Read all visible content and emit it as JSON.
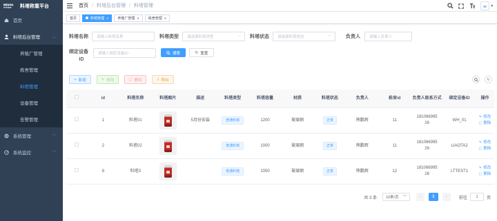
{
  "brand": {
    "logo_text": "智慧体系统 SYSTEM",
    "title": "料塔称重平台"
  },
  "sidebar": {
    "items": [
      {
        "label": "首页",
        "icon": "home-icon"
      },
      {
        "label": "料塔后台管理",
        "icon": "user-icon",
        "expanded": true
      },
      {
        "label": "系统管理",
        "icon": "gear-icon"
      },
      {
        "label": "系统监控",
        "icon": "monitor-icon"
      }
    ],
    "subitems": [
      {
        "label": "养殖厂管理"
      },
      {
        "label": "栋舍管理"
      },
      {
        "label": "料塔管理",
        "active": true
      },
      {
        "label": "设备管理"
      },
      {
        "label": "告警管理"
      }
    ]
  },
  "navbar": {
    "breadcrumb": [
      "首页",
      "料塔后台管理",
      "料塔管理"
    ],
    "icons": [
      "search-icon",
      "fullscreen-icon",
      "font-size-icon",
      "avatar"
    ]
  },
  "tags": [
    {
      "label": "首页",
      "active": false,
      "closable": false
    },
    {
      "label": "料塔管理",
      "active": true,
      "closable": true
    },
    {
      "label": "养殖厂管理",
      "active": false,
      "closable": true
    },
    {
      "label": "栋舍管理",
      "active": false,
      "closable": true
    }
  ],
  "search": {
    "name_label": "料塔名称",
    "name_placeholder": "请输入料塔名称",
    "type_label": "料塔类型",
    "type_placeholder": "请选择料塔类型",
    "status_label": "料塔状态",
    "status_placeholder": "请选择料塔状态",
    "owner_label": "负责人",
    "owner_placeholder": "请输入负责人",
    "device_label_line1": "绑定设备",
    "device_label_line2": "ID",
    "device_placeholder": "请输入绑定设备ID",
    "search_button": "搜索",
    "reset_button": "重置"
  },
  "toolbar": {
    "add": "新增",
    "edit": "修改",
    "delete": "删除",
    "export": "导出"
  },
  "table": {
    "headers": [
      "id",
      "料塔名称",
      "料塔图片",
      "描述",
      "料塔类型",
      "料塔容量",
      "材质",
      "料塔状态",
      "负责人",
      "栋舍id",
      "负责人联系方式",
      "绑定设备ID",
      "操作"
    ],
    "rows": [
      {
        "id": "1",
        "name": "料塔01",
        "desc": "5月份安装",
        "type": "普通料塔",
        "capacity": "1200",
        "material": "玻璃钢",
        "status": "正常",
        "owner": "熊鹏辉",
        "house_id": "11",
        "phone_l1": "181066995",
        "phone_l2": "26",
        "device": "WH_01",
        "op_edit": "修改",
        "op_delete": "删除"
      },
      {
        "id": "2",
        "name": "料塔02",
        "desc": "",
        "type": "普通料塔",
        "capacity": "1000",
        "material": "玻璃钢",
        "status": "正常",
        "owner": "熊鹏辉",
        "house_id": "11",
        "phone_l1": "181066995",
        "phone_l2": "26",
        "device": "LIAOTA2",
        "op_edit": "修改",
        "op_delete": "删除"
      },
      {
        "id": "8",
        "name": "料塔3",
        "desc": "",
        "type": "普通料塔",
        "capacity": "1050",
        "material": "玻璃钢",
        "status": "正常",
        "owner": "熊鹏辉",
        "house_id": "12",
        "phone_l1": "181066995",
        "phone_l2": "26",
        "device": "LTTEST1",
        "op_edit": "修改",
        "op_delete": "删除"
      }
    ]
  },
  "pagination": {
    "total_text": "共 3 条",
    "page_size": "10条/页",
    "current_page": "1",
    "goto_label": "前往",
    "goto_value": "1",
    "page_unit": "页"
  }
}
